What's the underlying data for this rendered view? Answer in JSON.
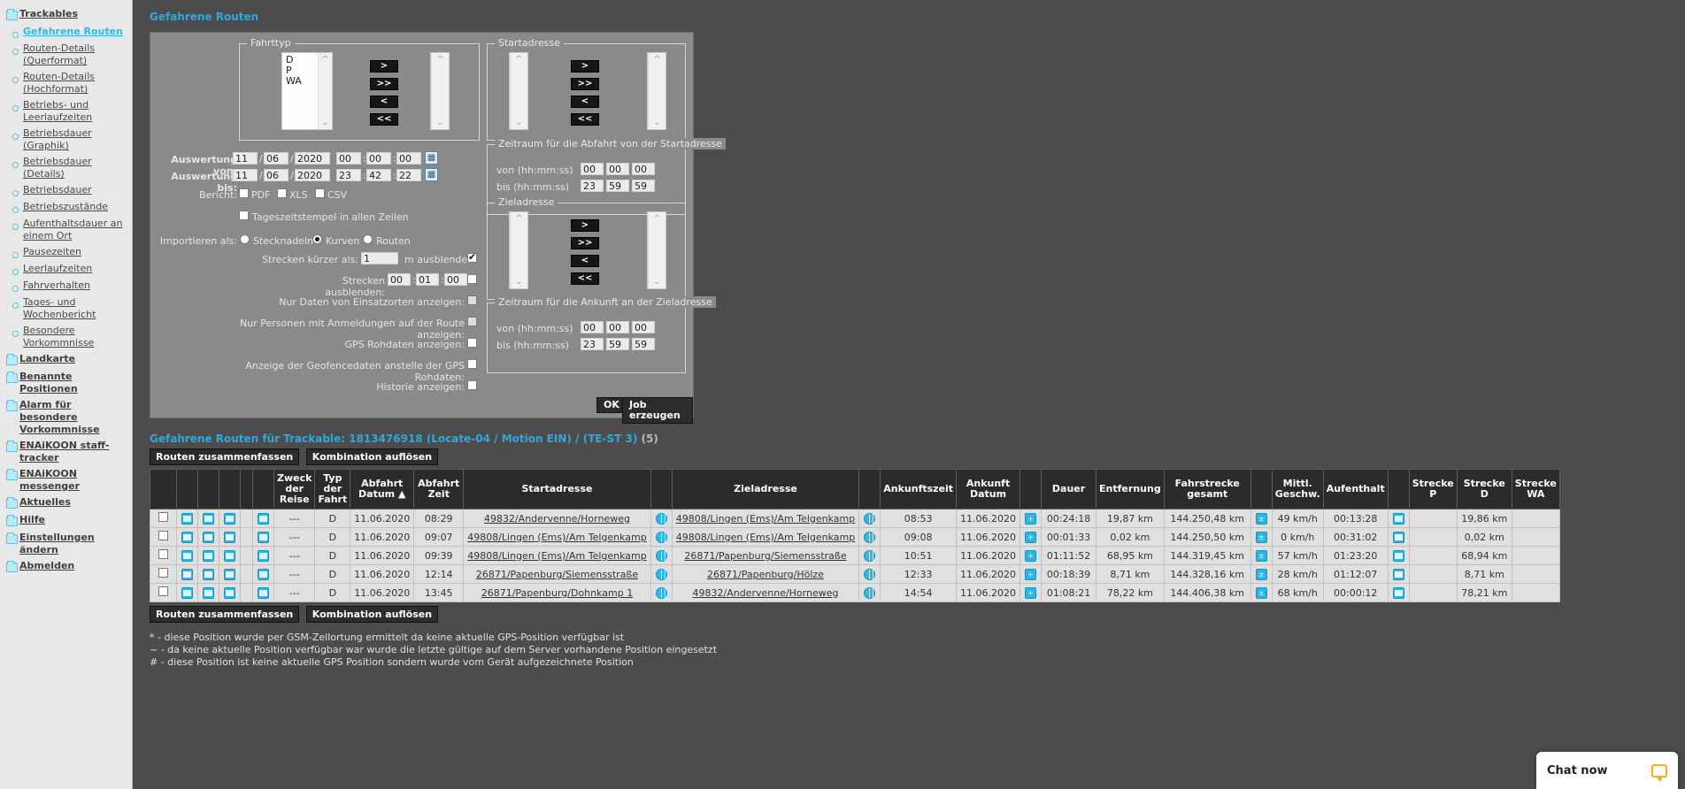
{
  "sidebar": {
    "items": [
      {
        "label": "Trackables",
        "type": "folder",
        "active": false
      },
      {
        "label": "Gefahrene Routen",
        "type": "leaf",
        "active": true
      },
      {
        "label": "Routen-Details (Querformat)",
        "type": "leaf",
        "active": false
      },
      {
        "label": "Routen-Details (Hochformat)",
        "type": "leaf",
        "active": false
      },
      {
        "label": "Betriebs- und Leerlaufzeiten",
        "type": "leaf",
        "active": false
      },
      {
        "label": "Betriebsdauer (Graphik)",
        "type": "leaf",
        "active": false
      },
      {
        "label": "Betriebsdauer (Details)",
        "type": "leaf",
        "active": false
      },
      {
        "label": "Betriebsdauer",
        "type": "leaf",
        "active": false
      },
      {
        "label": "Betriebszustände",
        "type": "leaf",
        "active": false
      },
      {
        "label": "Aufenthaltsdauer an einem Ort",
        "type": "leaf",
        "active": false
      },
      {
        "label": "Pausezeiten",
        "type": "leaf",
        "active": false
      },
      {
        "label": "Leerlaufzeiten",
        "type": "leaf",
        "active": false
      },
      {
        "label": "Fahrverhalten",
        "type": "leaf",
        "active": false
      },
      {
        "label": "Tages- und Wochenbericht",
        "type": "leaf",
        "active": false
      },
      {
        "label": "Besondere Vorkommnisse",
        "type": "leaf",
        "active": false
      },
      {
        "label": "Landkarte",
        "type": "folder",
        "active": false
      },
      {
        "label": "Benannte Positionen",
        "type": "folder",
        "active": false
      },
      {
        "label": "Alarm für besondere Vorkommnisse",
        "type": "folder",
        "active": false
      },
      {
        "label": "ENAiKOON staff-tracker",
        "type": "folder",
        "active": false
      },
      {
        "label": "ENAiKOON messenger",
        "type": "folder",
        "active": false
      },
      {
        "label": "Aktuelles",
        "type": "folder",
        "active": false
      },
      {
        "label": "Hilfe",
        "type": "folder",
        "active": false
      },
      {
        "label": "Einstellungen ändern",
        "type": "folder",
        "active": false
      },
      {
        "label": "Abmelden",
        "type": "folder",
        "active": false
      }
    ]
  },
  "page": {
    "title": "Gefahrene Routen"
  },
  "form": {
    "fahrttyp": {
      "legend": "Fahrttyp",
      "options": [
        "D",
        "P",
        "WA"
      ],
      "selected_options": [],
      "buttons": [
        ">",
        ">>",
        "<",
        "<<"
      ]
    },
    "startadresse": {
      "legend": "Startadresse",
      "options": [],
      "selected_options": [],
      "buttons": [
        ">",
        ">>",
        "<",
        "<<"
      ]
    },
    "zieladresse": {
      "legend": "Zieladresse",
      "options": [],
      "selected_options": [],
      "buttons": [
        ">",
        ">>",
        "<",
        "<<"
      ]
    },
    "abfahrt_zeitraum": {
      "legend": "Zeitraum für die Abfahrt von der Startadresse",
      "von_label": "von (hh:mm:ss)",
      "bis_label": "bis (hh:mm:ss)",
      "von": [
        "00",
        "00",
        "00"
      ],
      "bis": [
        "23",
        "59",
        "59"
      ]
    },
    "ankunft_zeitraum": {
      "legend": "Zeitraum für die Ankunft an der Zieladresse",
      "von_label": "von (hh:mm:ss)",
      "bis_label": "bis (hh:mm:ss)",
      "von": [
        "00",
        "00",
        "00"
      ],
      "bis": [
        "23",
        "59",
        "59"
      ]
    },
    "auswertung_von": {
      "label": "Auswertung von:",
      "tag": "11",
      "monat": "06",
      "jahr": "2020",
      "std": "00",
      "min": "00",
      "sek": "00",
      "calendar_icon": "calendar-icon"
    },
    "auswertung_bis": {
      "label": "Auswertung bis:",
      "tag": "11",
      "monat": "06",
      "jahr": "2020",
      "std": "23",
      "min": "42",
      "sek": "22",
      "calendar_icon": "calendar-icon"
    },
    "bericht": {
      "label": "Bericht:",
      "options": [
        {
          "label": "PDF",
          "checked": false
        },
        {
          "label": "XLS",
          "checked": false
        },
        {
          "label": "CSV",
          "checked": false
        }
      ]
    },
    "tageszeitstempel": {
      "label": "Tageszeitstempel in allen Zeilen",
      "checked": false
    },
    "importieren": {
      "label": "Importieren als:",
      "options": [
        {
          "label": "Stecknadeln",
          "selected": false
        },
        {
          "label": "Kurven",
          "selected": true
        },
        {
          "label": "Routen",
          "selected": false
        }
      ]
    },
    "strecken_kuerzer": {
      "label": "Strecken kürzer als:",
      "value": "1",
      "suffix": "m ausblenden:",
      "checked": true
    },
    "strecken_ausblenden": {
      "label": "Strecken ausblenden:",
      "std": "00",
      "min": "01",
      "sek": "00",
      "checked": false
    },
    "checkbox_rows": [
      {
        "label": "Nur Daten von Einsatzorten anzeigen:",
        "checked": false,
        "dim": true
      },
      {
        "label": "Nur Personen mit Anmeldungen auf der Route anzeigen:",
        "checked": false,
        "dim": true
      },
      {
        "label": "GPS Rohdaten anzeigen:",
        "checked": false,
        "dim": false
      },
      {
        "label": "Anzeige der Geofencedaten anstelle der GPS Rohdaten:",
        "checked": false,
        "dim": false
      },
      {
        "label": "Historie anzeigen:",
        "checked": false,
        "dim": false
      }
    ],
    "ok_label": "OK",
    "job_label": "Job erzeugen"
  },
  "results": {
    "title": "Gefahrene Routen für Trackable: 1813476918 (Locate-04 / Motion EIN) / (TE-ST 3)",
    "count": "(5)",
    "btn_zusammenfassen": "Routen zusammenfassen",
    "btn_aufloesen": "Kombination auflösen",
    "columns": [
      "",
      "",
      "",
      "",
      "",
      "",
      "Zweck der Reise",
      "Typ der Fahrt",
      "Abfahrt Datum ▲",
      "Abfahrt Zeit",
      "Startadresse",
      "",
      "Zieladresse",
      "",
      "Ankunftszeit",
      "Ankunft Datum",
      "",
      "Dauer",
      "Entfernung",
      "Fahrstrecke gesamt",
      "",
      "Mittl. Geschw.",
      "Aufenthalt",
      "",
      "Strecke P",
      "Strecke D",
      "Strecke WA"
    ],
    "rows": [
      {
        "zweck": "---",
        "typ": "D",
        "abfahrt_datum": "11.06.2020",
        "abfahrt_zeit": "08:29",
        "startadresse": "49832/Andervenne/Horneweg",
        "zieladresse": "49808/Lingen (Ems)/Am Telgenkamp",
        "ankunftszeit": "08:53",
        "ankunft_datum": "11.06.2020",
        "dauer": "00:24:18",
        "entfernung": "19,87 km",
        "fahrstrecke": "144.250,48 km",
        "geschw": "49 km/h",
        "aufenthalt": "00:13:28",
        "strecke_p": "",
        "strecke_d": "19,86 km",
        "strecke_wa": ""
      },
      {
        "zweck": "---",
        "typ": "D",
        "abfahrt_datum": "11.06.2020",
        "abfahrt_zeit": "09:07",
        "startadresse": "49808/Lingen (Ems)/Am Telgenkamp",
        "zieladresse": "49808/Lingen (Ems)/Am Telgenkamp",
        "ankunftszeit": "09:08",
        "ankunft_datum": "11.06.2020",
        "dauer": "00:01:33",
        "entfernung": "0,02 km",
        "fahrstrecke": "144.250,50 km",
        "geschw": "0 km/h",
        "aufenthalt": "00:31:02",
        "strecke_p": "",
        "strecke_d": "0,02 km",
        "strecke_wa": ""
      },
      {
        "zweck": "---",
        "typ": "D",
        "abfahrt_datum": "11.06.2020",
        "abfahrt_zeit": "09:39",
        "startadresse": "49808/Lingen (Ems)/Am Telgenkamp",
        "zieladresse": "26871/Papenburg/Siemensstraße",
        "ankunftszeit": "10:51",
        "ankunft_datum": "11.06.2020",
        "dauer": "01:11:52",
        "entfernung": "68,95 km",
        "fahrstrecke": "144.319,45 km",
        "geschw": "57 km/h",
        "aufenthalt": "01:23:20",
        "strecke_p": "",
        "strecke_d": "68,94 km",
        "strecke_wa": ""
      },
      {
        "zweck": "---",
        "typ": "D",
        "abfahrt_datum": "11.06.2020",
        "abfahrt_zeit": "12:14",
        "startadresse": "26871/Papenburg/Siemensstraße",
        "zieladresse": "26871/Papenburg/Hölze",
        "ankunftszeit": "12:33",
        "ankunft_datum": "11.06.2020",
        "dauer": "00:18:39",
        "entfernung": "8,71 km",
        "fahrstrecke": "144.328,16 km",
        "geschw": "28 km/h",
        "aufenthalt": "01:12:07",
        "strecke_p": "",
        "strecke_d": "8,71 km",
        "strecke_wa": ""
      },
      {
        "zweck": "---",
        "typ": "D",
        "abfahrt_datum": "11.06.2020",
        "abfahrt_zeit": "13:45",
        "startadresse": "26871/Papenburg/Dohnkamp 1",
        "zieladresse": "49832/Andervenne/Horneweg",
        "ankunftszeit": "14:54",
        "ankunft_datum": "11.06.2020",
        "dauer": "01:08:21",
        "entfernung": "78,22 km",
        "fahrstrecke": "144.406,38 km",
        "geschw": "68 km/h",
        "aufenthalt": "00:00:12",
        "strecke_p": "",
        "strecke_d": "78,21 km",
        "strecke_wa": ""
      }
    ],
    "footnotes": [
      "* - diese Position wurde per GSM-Zellortung ermittelt da keine aktuelle GPS-Position verfügbar ist",
      "~ - da keine aktuelle Position verfügbar war wurde die letzte gültige auf dem Server vorhandene Position eingesetzt",
      "# - diese Position ist keine aktuelle GPS Position sondern wurde vom Gerät aufgezeichnete Position"
    ]
  },
  "chat": {
    "label": "Chat now",
    "icon": "chat-bubble-icon"
  },
  "colors": {
    "accent": "#2fa8dd",
    "panel": "#8a8a8a",
    "background": "#4c4c4c",
    "icon_blue": "#29b6e8",
    "chat_yellow": "#f2b01e"
  }
}
